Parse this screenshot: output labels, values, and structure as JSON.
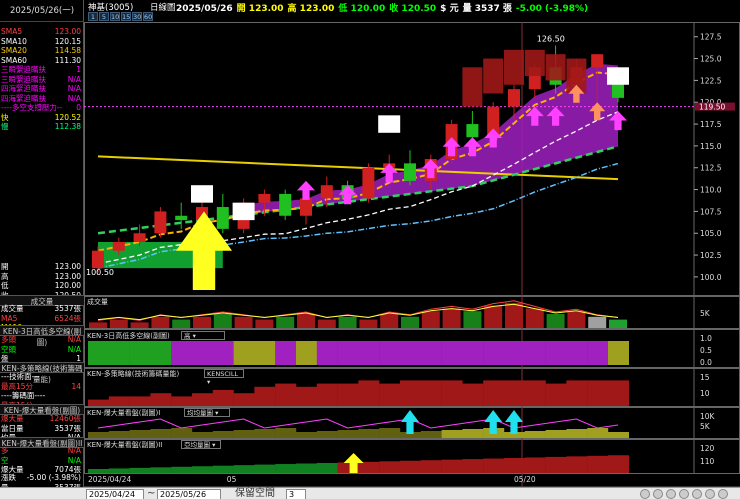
{
  "left": {
    "date": "2025/05/26(一)",
    "indicators": [
      {
        "k": "SMA5",
        "v": "123.00",
        "color": "#ff4040"
      },
      {
        "k": "SMA10",
        "v": "120.15",
        "color": "#ffffff"
      },
      {
        "k": "SMA20",
        "v": "114.58",
        "color": "#ffd000"
      },
      {
        "k": "SMA60",
        "v": "111.30",
        "color": "#ffffff"
      },
      {
        "k": "三瞬緊迫瞞扶",
        "v": "1",
        "color": "#ff00ff"
      },
      {
        "k": "三瞬緊迫瞞扶",
        "v": "N/A",
        "color": "#ff00ff"
      },
      {
        "k": "四海緊迫瞞扶",
        "v": "N/A",
        "color": "#ff00ff"
      },
      {
        "k": "四海緊迫瞞扶",
        "v": "N/A",
        "color": "#ff00ff"
      },
      {
        "k": "----多空支撐壓力--",
        "v": "0",
        "color": "#ff00ff"
      },
      {
        "k": "快",
        "v": "120.52",
        "color": "#ffff00"
      },
      {
        "k": "慢",
        "v": "112.38",
        "color": "#00ff80"
      }
    ],
    "ohlc": [
      {
        "k": "開",
        "v": "123.00",
        "color": "#ffffff"
      },
      {
        "k": "高",
        "v": "123.00",
        "color": "#ffffff"
      },
      {
        "k": "低",
        "v": "120.00",
        "color": "#ffffff"
      },
      {
        "k": "收",
        "v": "120.50",
        "color": "#ffffff"
      }
    ],
    "vol_head": "成交量",
    "vol": [
      {
        "k": "成交量",
        "v": "3537張",
        "color": "#ffffff"
      },
      {
        "k": "MA5",
        "v": "6524張",
        "color": "#ff4040"
      },
      {
        "k": "MA10",
        "v": "",
        "color": "#ffff00"
      }
    ],
    "ken1_head": "KEN-3日高低多空線(副圖)",
    "ken1": [
      {
        "k": "多頭",
        "v": "N/A",
        "color": "#ff4040"
      },
      {
        "k": "空頭",
        "v": "N/A",
        "color": "#00ff00"
      },
      {
        "k": "盤",
        "v": "1",
        "color": "#ffffff"
      }
    ],
    "ken2_head": "KEN-多策略線(技術籌碼量能)",
    "ken2": [
      {
        "k": "---技術面---",
        "v": "",
        "color": "#ffffff"
      },
      {
        "k": "最高15分",
        "v": "14",
        "color": "#ff4040"
      },
      {
        "k": "----籌碼面----",
        "v": "",
        "color": "#ffffff"
      },
      {
        "k": "最高15分",
        "v": "",
        "color": "#ff4040"
      }
    ],
    "ken3_head": "KEN-爆大量看盤(副圖)",
    "ken3": [
      {
        "k": "爆大量",
        "v": "12460張",
        "color": "#ff4040"
      },
      {
        "k": "當日量",
        "v": "3537張",
        "color": "#ffffff"
      },
      {
        "k": "均量",
        "v": "N/A",
        "color": "#ffffff"
      }
    ],
    "ken4_head": "KEN-爆大量看盤(副圖)II",
    "ken4": [
      {
        "k": "多",
        "v": "N/A",
        "color": "#ff4040"
      },
      {
        "k": "空",
        "v": "N/A",
        "color": "#00ff00"
      },
      {
        "k": "爆大量",
        "v": "7074張",
        "color": "#ffffff"
      }
    ],
    "bottom": [
      {
        "k": "漲跌",
        "v": "-5.00 (-3.98%)",
        "color": "#ffffff"
      },
      {
        "k": "量",
        "v": "3537張",
        "color": "#ffffff"
      }
    ]
  },
  "toolbar": {
    "stock_name": "神基(3005)",
    "period": "日線圖",
    "timeframes": [
      "1",
      "5",
      "10",
      "15",
      "30",
      "60"
    ],
    "quote": [
      {
        "t": "2025/05/26",
        "c": "#ffffff"
      },
      {
        "t": "開 123.00",
        "c": "#ffff00"
      },
      {
        "t": "高 123.00",
        "c": "#ffff00"
      },
      {
        "t": "低 120.00",
        "c": "#00ff00"
      },
      {
        "t": "收 120.50",
        "c": "#00ff00"
      },
      {
        "t": "$ 元",
        "c": "#ffffff"
      },
      {
        "t": "量 3537 張",
        "c": "#ffffff"
      },
      {
        "t": "-5.00 (-3.98%)",
        "c": "#00ff00"
      }
    ]
  },
  "chart_data": {
    "type": "candlestick",
    "y_ticks": [
      100.0,
      102.5,
      105.0,
      107.5,
      110.0,
      112.5,
      115.0,
      117.5,
      120.0,
      122.5,
      125.0,
      127.5
    ],
    "ylim": [
      98.5,
      128.5
    ],
    "high_label": "126.50",
    "low_label": "100.50",
    "current_label": "119.50",
    "x_labels": [
      "2025/04/24",
      "05",
      "05/20"
    ],
    "candles": [
      {
        "o": 101.0,
        "h": 103.5,
        "l": 100.5,
        "c": 103.0
      },
      {
        "o": 103.0,
        "h": 104.5,
        "l": 102.5,
        "c": 104.0
      },
      {
        "o": 104.0,
        "h": 106.0,
        "l": 103.5,
        "c": 105.0
      },
      {
        "o": 105.0,
        "h": 108.0,
        "l": 104.5,
        "c": 107.5
      },
      {
        "o": 107.0,
        "h": 108.5,
        "l": 105.5,
        "c": 106.5
      },
      {
        "o": 106.5,
        "h": 109.0,
        "l": 105.5,
        "c": 108.0
      },
      {
        "o": 108.0,
        "h": 109.5,
        "l": 105.0,
        "c": 105.5
      },
      {
        "o": 105.5,
        "h": 109.0,
        "l": 105.0,
        "c": 108.5
      },
      {
        "o": 108.5,
        "h": 110.0,
        "l": 107.0,
        "c": 109.5
      },
      {
        "o": 109.5,
        "h": 110.0,
        "l": 106.5,
        "c": 107.0
      },
      {
        "o": 107.0,
        "h": 110.0,
        "l": 106.0,
        "c": 109.0
      },
      {
        "o": 109.0,
        "h": 111.5,
        "l": 108.0,
        "c": 110.5
      },
      {
        "o": 110.5,
        "h": 111.0,
        "l": 108.5,
        "c": 109.0
      },
      {
        "o": 109.0,
        "h": 113.0,
        "l": 108.5,
        "c": 112.5
      },
      {
        "o": 112.5,
        "h": 114.0,
        "l": 111.5,
        "c": 113.0
      },
      {
        "o": 113.0,
        "h": 114.5,
        "l": 110.5,
        "c": 111.0
      },
      {
        "o": 111.0,
        "h": 114.0,
        "l": 110.0,
        "c": 113.5
      },
      {
        "o": 113.5,
        "h": 118.0,
        "l": 113.0,
        "c": 117.5
      },
      {
        "o": 117.5,
        "h": 119.0,
        "l": 115.0,
        "c": 116.0
      },
      {
        "o": 116.0,
        "h": 120.0,
        "l": 115.5,
        "c": 119.5
      },
      {
        "o": 119.5,
        "h": 122.0,
        "l": 118.0,
        "c": 121.5
      },
      {
        "o": 121.5,
        "h": 124.5,
        "l": 120.5,
        "c": 124.0
      },
      {
        "o": 124.0,
        "h": 126.5,
        "l": 121.0,
        "c": 122.0
      },
      {
        "o": 122.0,
        "h": 125.0,
        "l": 120.5,
        "c": 124.0
      },
      {
        "o": 124.0,
        "h": 125.5,
        "l": 120.0,
        "c": 125.5
      },
      {
        "o": 123.0,
        "h": 123.0,
        "l": 120.0,
        "c": 120.5
      }
    ],
    "volume_pane": {
      "label": "成交量",
      "tick": "5K"
    },
    "ken1_pane": {
      "label": "KEN-3日高低多空線(副圖)",
      "dropdown": "高",
      "ticks": [
        "1.0",
        "0.5",
        "0.0"
      ]
    },
    "ken2_pane": {
      "label": "KEN-多策略線(技術籌碼量能)",
      "dropdown": "KENSCILL",
      "ticks": [
        "15",
        "10"
      ]
    },
    "ken3_pane": {
      "label": "KEN-爆大量看盤(副圖)I",
      "dropdown": "均均量圖",
      "ticks": [
        "10K",
        "5K"
      ]
    },
    "ken4_pane": {
      "label": "KEN-爆大量看盤(副圖)II",
      "dropdown": "亞均量圖",
      "ticks": [
        "120",
        "110"
      ]
    }
  },
  "statusbar": {
    "date_from": "2025/04/24",
    "date_to": "2025/05/26",
    "reserve_label": "保留空間",
    "reserve_value": "3"
  }
}
